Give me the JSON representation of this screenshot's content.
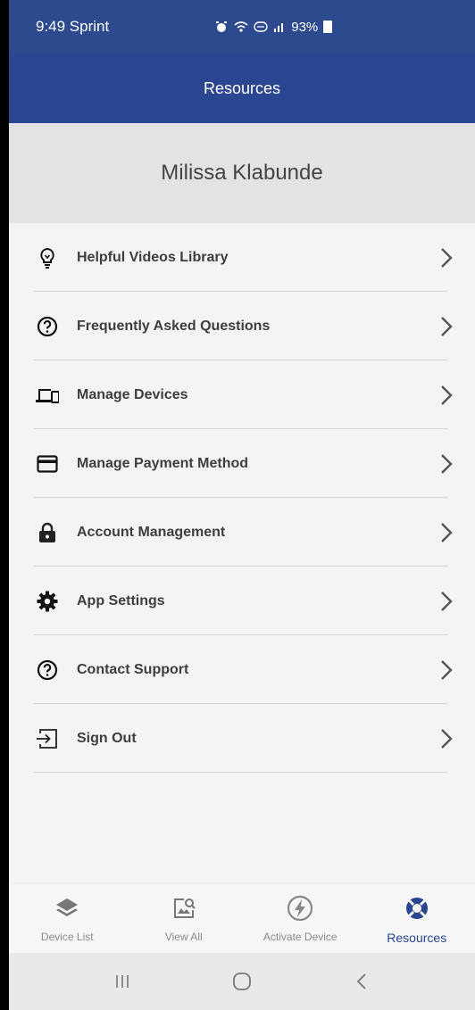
{
  "status_bar": {
    "time": "9:49 Sprint",
    "battery": "93%"
  },
  "header": {
    "title": "Resources"
  },
  "profile": {
    "name": "Milissa Klabunde"
  },
  "menu": {
    "items": [
      {
        "label": "Helpful Videos Library",
        "icon": "lightbulb-icon"
      },
      {
        "label": "Frequently Asked Questions",
        "icon": "question-circle-icon"
      },
      {
        "label": "Manage Devices",
        "icon": "devices-icon"
      },
      {
        "label": "Manage Payment Method",
        "icon": "credit-card-icon"
      },
      {
        "label": "Account Management",
        "icon": "lock-icon"
      },
      {
        "label": "App Settings",
        "icon": "gear-icon"
      },
      {
        "label": "Contact Support",
        "icon": "question-circle-icon"
      },
      {
        "label": "Sign Out",
        "icon": "sign-out-icon"
      }
    ]
  },
  "bottom_nav": {
    "items": [
      {
        "label": "Device List",
        "icon": "layers-icon"
      },
      {
        "label": "View All",
        "icon": "image-search-icon"
      },
      {
        "label": "Activate Device",
        "icon": "lightning-icon"
      },
      {
        "label": "Resources",
        "icon": "lifebuoy-icon",
        "active": true
      }
    ]
  },
  "colors": {
    "header_bg": "#2a4690",
    "active_nav": "#2a4690",
    "label_text": "#3e3e3e"
  }
}
